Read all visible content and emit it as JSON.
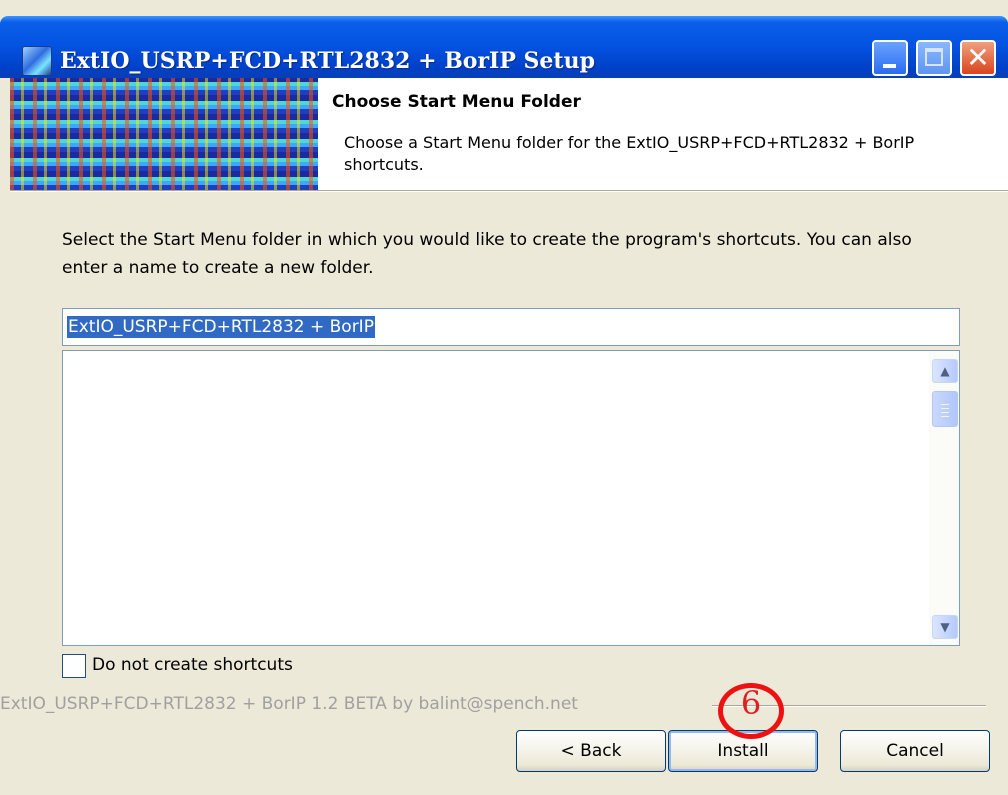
{
  "window": {
    "title": "ExtIO_USRP+FCD+RTL2832 + BorIP Setup"
  },
  "header": {
    "title": "Choose Start Menu Folder",
    "subtitle": "Choose a Start Menu folder for the ExtIO_USRP+FCD+RTL2832 + BorIP shortcuts."
  },
  "body": {
    "instructions": "Select the Start Menu folder in which you would like to create the program's shortcuts. You can also enter a name to create a new folder.",
    "folder_input_value": "ExtIO_USRP+FCD+RTL2832 + BorIP",
    "folder_list_items": [],
    "no_shortcuts_label": "Do not create shortcuts",
    "no_shortcuts_checked": false
  },
  "footer": {
    "branding": "ExtIO_USRP+FCD+RTL2832 + BorIP 1.2 BETA by balint@spench.net",
    "back_label": "< Back",
    "install_label": "Install",
    "cancel_label": "Cancel"
  },
  "annotation": {
    "step_number": "6",
    "color": "#ee1111"
  },
  "colors": {
    "titlebar": "#0454e3",
    "dialog_bg": "#ece9d8",
    "selection": "#316ac5"
  }
}
